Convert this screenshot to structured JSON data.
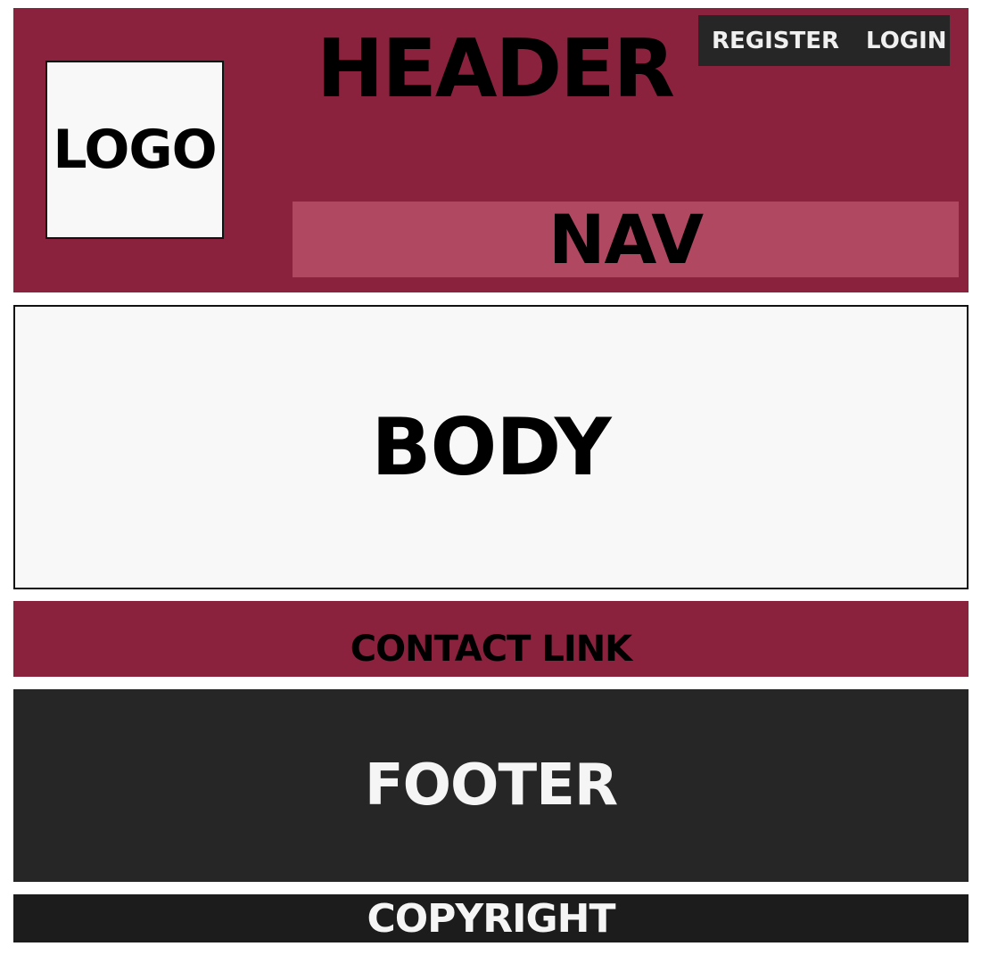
{
  "header": {
    "title": "HEADER",
    "logo_text": "LOGO",
    "auth": {
      "register_label": "REGISTER",
      "login_label": "LOGIN"
    },
    "nav_label": "NAV"
  },
  "main": {
    "body_label": "BODY"
  },
  "contact": {
    "link_label": "CONTACT LINK"
  },
  "footer": {
    "label": "FOOTER",
    "copyright": "COPYRIGHT"
  },
  "colors": {
    "brand": "#8a213d",
    "nav": "#b04862",
    "dark": "#262626",
    "darker": "#1c1c1c",
    "light": "#f8f8f8"
  }
}
